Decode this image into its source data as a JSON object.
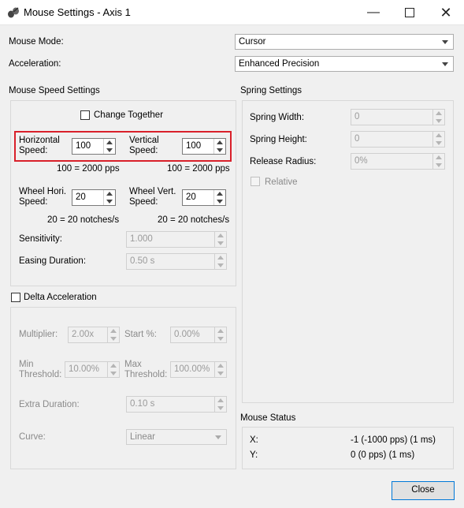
{
  "window": {
    "title": "Mouse Settings - Axis 1"
  },
  "top": {
    "mouse_mode_label": "Mouse Mode:",
    "mouse_mode_value": "Cursor",
    "acceleration_label": "Acceleration:",
    "acceleration_value": "Enhanced Precision"
  },
  "speed": {
    "group_title": "Mouse Speed Settings",
    "change_together": "Change Together",
    "horizontal_label_1": "Horizontal",
    "horizontal_label_2": "Speed:",
    "horizontal_value": "100",
    "vertical_label_1": "Vertical",
    "vertical_label_2": "Speed:",
    "vertical_value": "100",
    "h_pps": "100 = 2000 pps",
    "v_pps": "100 = 2000 pps",
    "wheel_h_label_1": "Wheel Hori.",
    "wheel_h_label_2": "Speed:",
    "wheel_h_value": "20",
    "wheel_v_label_1": "Wheel Vert.",
    "wheel_v_label_2": "Speed:",
    "wheel_v_value": "20",
    "wheel_h_note": "20 = 20 notches/s",
    "wheel_v_note": "20 = 20 notches/s",
    "sensitivity_label": "Sensitivity:",
    "sensitivity_value": "1.000",
    "easing_label": "Easing Duration:",
    "easing_value": "0.50 s"
  },
  "delta": {
    "title": "Delta Acceleration",
    "multiplier_label": "Multiplier:",
    "multiplier_value": "2.00x",
    "start_label": "Start %:",
    "start_value": "0.00%",
    "min_label_1": "Min",
    "min_label_2": "Threshold:",
    "min_value": "10.00%",
    "max_label_1": "Max",
    "max_label_2": "Threshold:",
    "max_value": "100.00%",
    "extra_label": "Extra Duration:",
    "extra_value": "0.10 s",
    "curve_label": "Curve:",
    "curve_value": "Linear"
  },
  "spring": {
    "title": "Spring Settings",
    "width_label": "Spring Width:",
    "width_value": "0",
    "height_label": "Spring Height:",
    "height_value": "0",
    "radius_label": "Release Radius:",
    "radius_value": "0%",
    "relative": "Relative"
  },
  "status": {
    "title": "Mouse Status",
    "x_label": "X:",
    "x_value": "-1 (-1000 pps) (1 ms)",
    "y_label": "Y:",
    "y_value": "0 (0 pps) (1 ms)"
  },
  "close_button": "Close",
  "colors": {
    "highlight": "#d9202a",
    "accent": "#0078d7"
  }
}
